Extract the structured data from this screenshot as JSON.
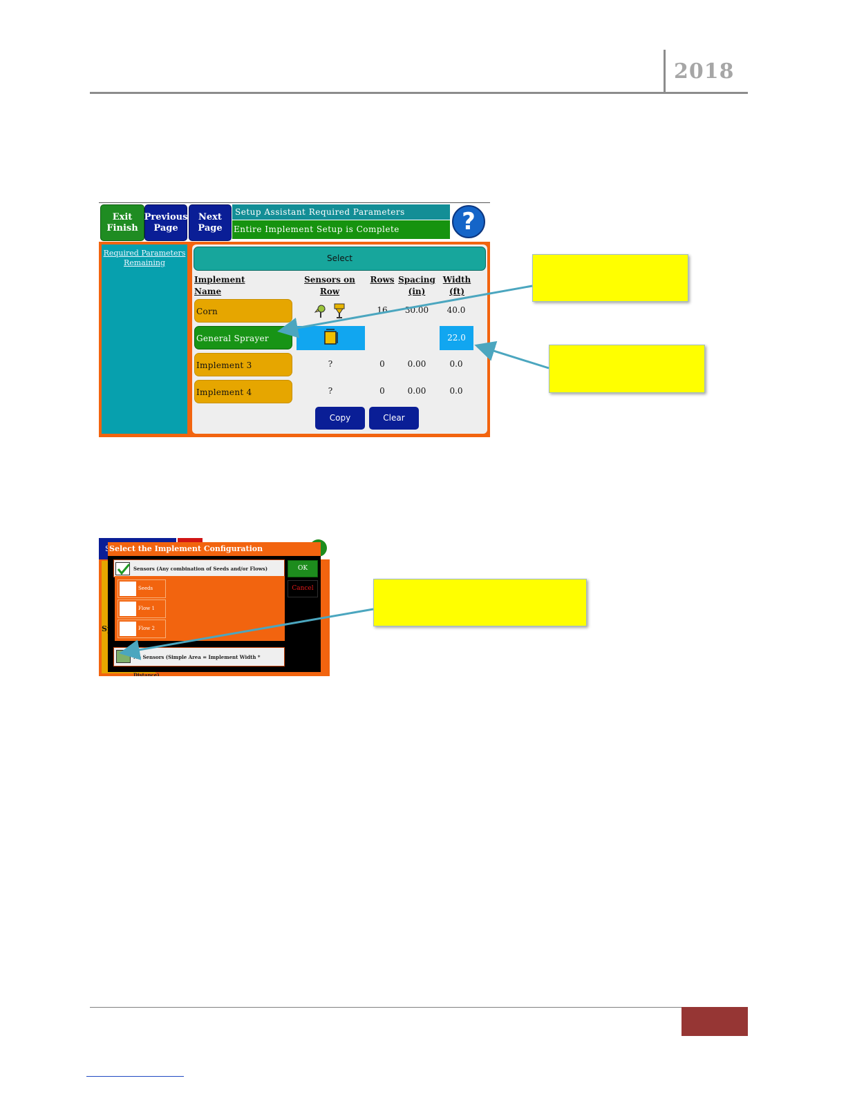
{
  "header": {
    "year": "2018"
  },
  "screen1": {
    "buttons": {
      "exit": [
        "Exit",
        "Finish"
      ],
      "previous": [
        "Previous",
        "Page"
      ],
      "next": [
        "Next",
        "Page"
      ]
    },
    "status_title": "Setup Assistant Required Parameters",
    "status_message": "Entire Implement Setup is Complete",
    "help_glyph": "?",
    "sidebar_link": [
      "Required Parameters",
      "Remaining"
    ],
    "select_label": "Select",
    "columns": {
      "name": "Implement Name",
      "sensors": "Sensors on Row",
      "rows": "Rows",
      "spacing": [
        "Spacing",
        "(in)"
      ],
      "width": [
        "Width",
        "(ft)"
      ]
    },
    "implements": [
      {
        "name": "Corn",
        "sensors": "",
        "rows": "16",
        "spacing": "30.00",
        "width": "40.0",
        "state": "normal"
      },
      {
        "name": "General Sprayer",
        "sensors": "",
        "rows": "",
        "spacing": "",
        "width": "22.0",
        "state": "selected"
      },
      {
        "name": "Implement 3",
        "sensors": "?",
        "rows": "0",
        "spacing": "0.00",
        "width": "0.0",
        "state": "normal"
      },
      {
        "name": "Implement 4",
        "sensors": "?",
        "rows": "0",
        "spacing": "0.00",
        "width": "0.0",
        "state": "normal"
      }
    ],
    "copy_label": "Copy",
    "clear_label": "Clear"
  },
  "screen2": {
    "behind_fragment_1": "S",
    "behind_fragment_2": "Sp",
    "title": "Select the Implement Configuration",
    "sensors_option": "Sensors (Any combination of Seeds and/or Flows)",
    "sub_options": [
      "Seeds",
      "Flow 1",
      "Flow 2"
    ],
    "no_sensors_option": "No Sensors (Simple Area = Implement Width * Distance)",
    "ok_label": "OK",
    "cancel_label": "Cancel"
  },
  "colors": {
    "accent_orange": "#f2640f",
    "callout_yellow": "#ffff00",
    "footer_red": "#963634",
    "button_blue": "#0a1e96",
    "button_green": "#1f8c22"
  }
}
